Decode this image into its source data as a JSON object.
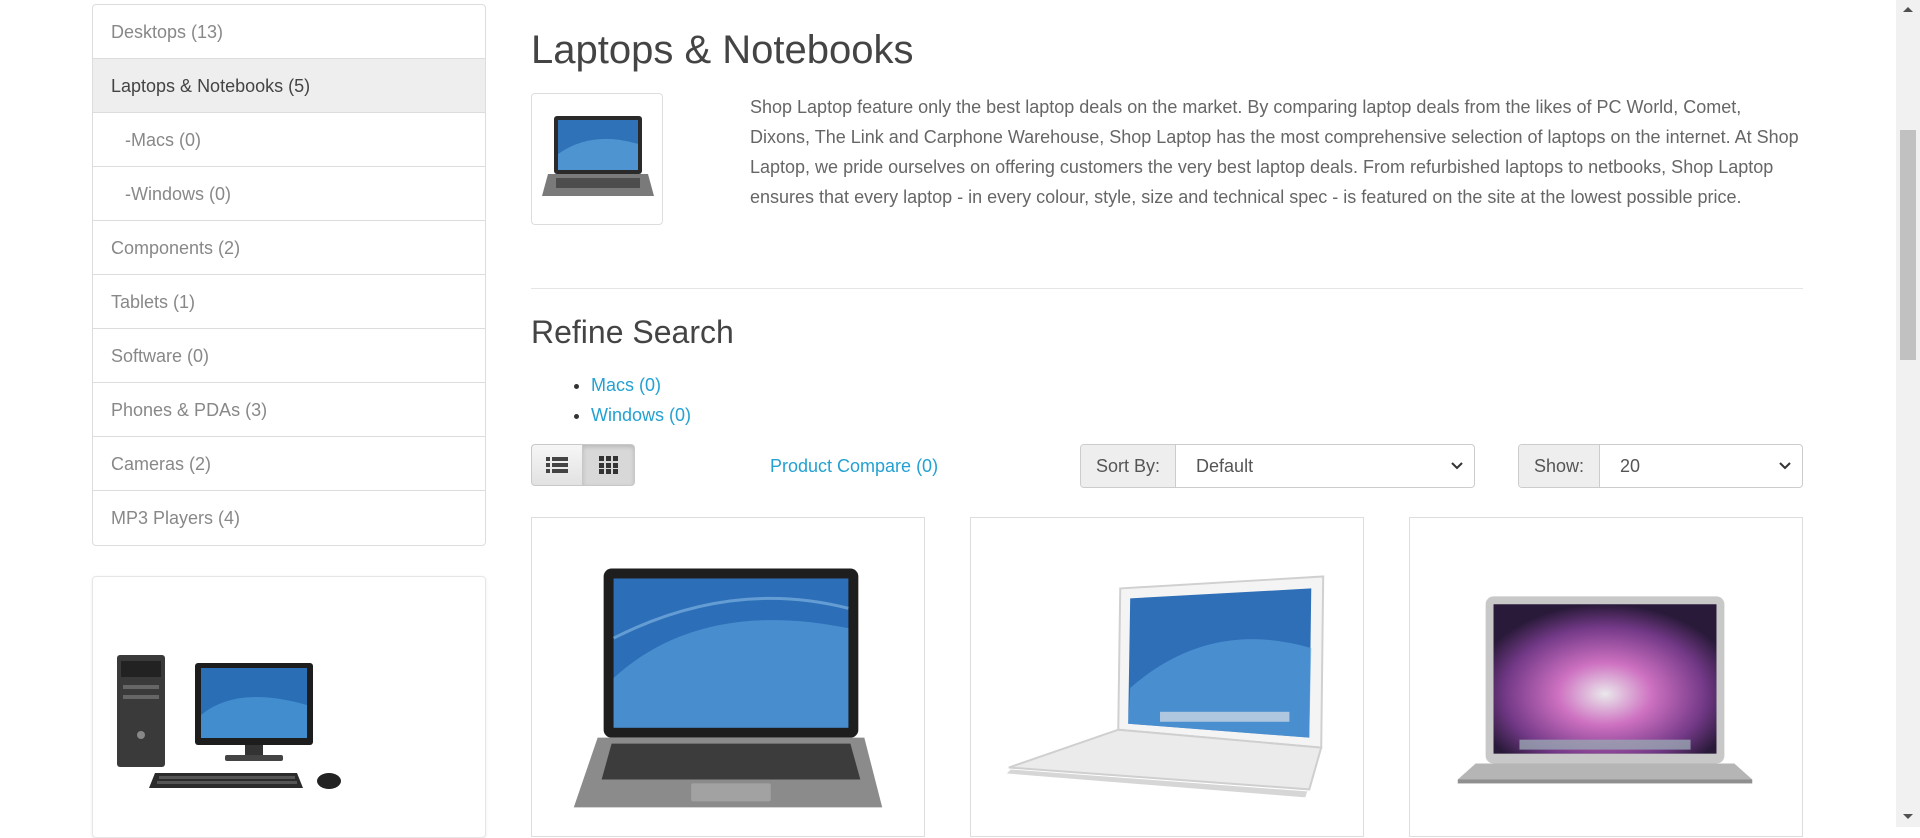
{
  "sidebar": {
    "categories": [
      {
        "label": "Desktops (13)"
      },
      {
        "label": "Laptops & Notebooks (5)"
      },
      {
        "label": "-Macs (0)"
      },
      {
        "label": "-Windows (0)"
      },
      {
        "label": "Components (2)"
      },
      {
        "label": "Tablets (1)"
      },
      {
        "label": "Software (0)"
      },
      {
        "label": "Phones & PDAs (3)"
      },
      {
        "label": "Cameras (2)"
      },
      {
        "label": "MP3 Players (4)"
      }
    ],
    "banner_icon": "desktop-computer-image"
  },
  "category": {
    "title": "Laptops & Notebooks",
    "thumb_icon": "laptop-image",
    "description": "Shop Laptop feature only the best laptop deals on the market. By comparing laptop deals from the likes of PC World, Comet, Dixons, The Link and Carphone Warehouse, Shop Laptop has the most comprehensive selection of laptops on the internet. At Shop Laptop, we pride ourselves on offering customers the very best laptop deals. From refurbished laptops to netbooks, Shop Laptop ensures that every laptop - in every colour, style, size and technical spec - is featured on the site at the lowest possible price."
  },
  "refine": {
    "title": "Refine Search",
    "links": [
      "Macs (0)",
      "Windows (0)"
    ]
  },
  "toolbar": {
    "list_view_icon": "list-icon",
    "grid_view_icon": "grid-icon",
    "compare_label": "Product Compare (0)",
    "sort_label": "Sort By:",
    "sort_value": "Default",
    "show_label": "Show:",
    "show_value": "20"
  },
  "products": [
    {
      "image": "hp-laptop-image"
    },
    {
      "image": "white-macbook-image"
    },
    {
      "image": "macbook-air-image"
    }
  ],
  "colors": {
    "link": "#23a1d1",
    "active_item_bg": "#eeeeee",
    "border": "#dddddd"
  }
}
